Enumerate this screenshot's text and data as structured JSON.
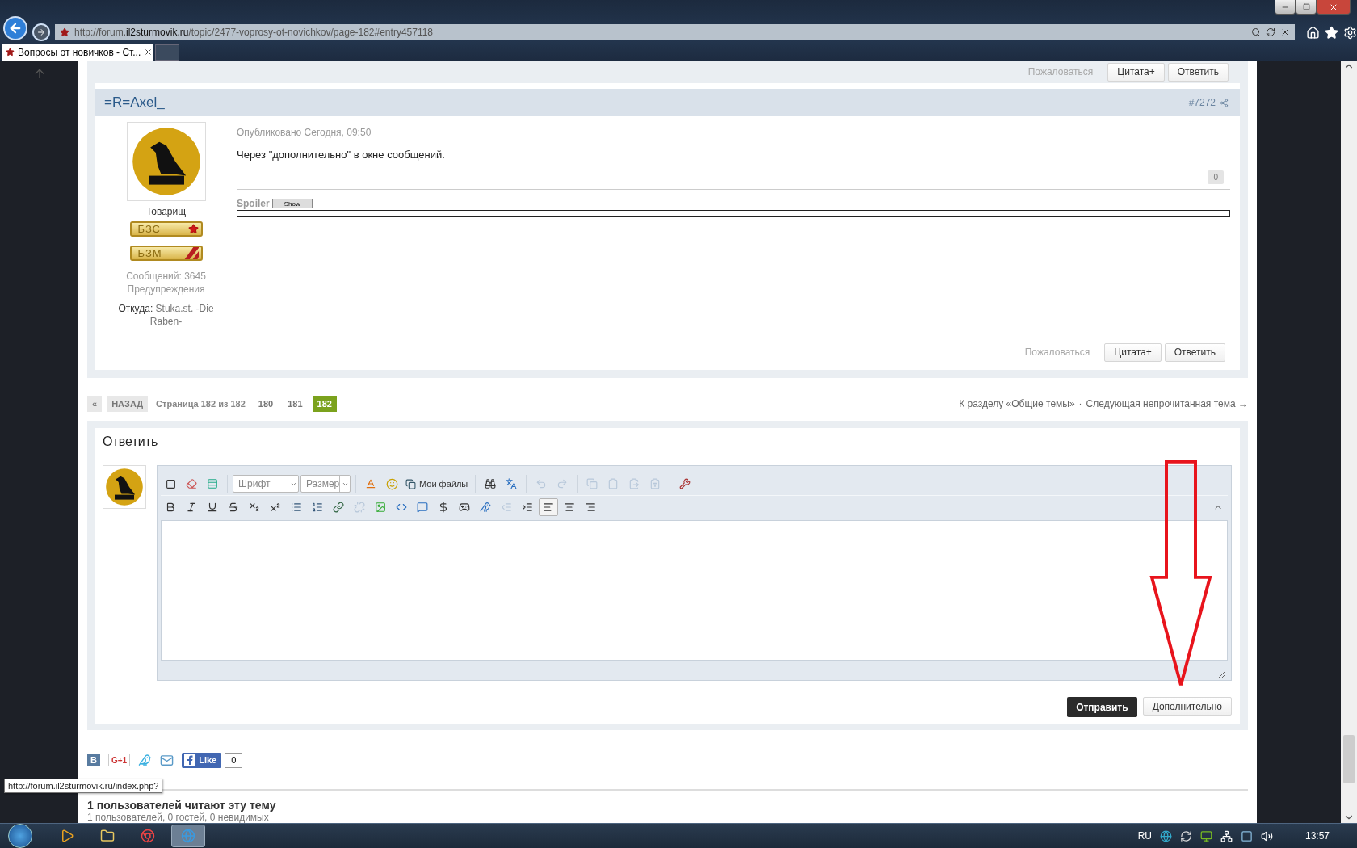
{
  "browser": {
    "url_prefix": "http://forum.",
    "url_domain": "il2sturmovik.ru",
    "url_path": "/topic/2477-voprosy-ot-novichkov/page-182#entry457118",
    "tab_title": "Вопросы от новичков - Ст..."
  },
  "prev_post_actions": {
    "report": "Пожаловаться",
    "quote": "Цитата+",
    "reply": "Ответить"
  },
  "post": {
    "author": "=R=Axel_",
    "number": "#7272",
    "rank": "Товарищ",
    "badges": [
      {
        "label": "БЗС",
        "kind": "star"
      },
      {
        "label": "БЗМ",
        "kind": "stripes"
      }
    ],
    "posts": "Сообщений: 3645",
    "warnings": "Предупреждения",
    "from_label": "Откуда:",
    "from_value": "Stuka.st. -Die Raben-",
    "published": "Опубликовано Сегодня, 09:50",
    "body": "Через \"дополнительно\" в окне сообщений.",
    "reputation": "0",
    "spoiler_label": "Spoiler",
    "spoiler_button": "Show",
    "actions": {
      "report": "Пожаловаться",
      "quote": "Цитата+",
      "reply": "Ответить"
    }
  },
  "pagination": {
    "first": "«",
    "prev": "НАЗАД",
    "info": "Страница 182 из 182",
    "pages": [
      {
        "label": "180",
        "selected": false
      },
      {
        "label": "181",
        "selected": false
      },
      {
        "label": "182",
        "selected": true
      }
    ],
    "forum_link": "К разделу «Общие темы»",
    "separator": "·",
    "next_unread": "Следующая непрочитанная тема →"
  },
  "reply": {
    "title": "Ответить",
    "font_select": "Шрифт",
    "size_select": "Размер",
    "files": "Мои файлы",
    "submit": "Отправить",
    "more": "Дополнительно",
    "history_disabled": true,
    "clipboard_disabled": true,
    "outdent_disabled": true,
    "align": [
      {
        "selected": true
      },
      {
        "selected": false
      },
      {
        "selected": false
      }
    ]
  },
  "share": {
    "vk": "B",
    "gplus": "G+1",
    "like": "Like",
    "like_count": "0"
  },
  "online": {
    "heading": "1 пользователей читают эту тему",
    "detail": "1 пользователей, 0 гостей, 0 невидимых"
  },
  "status_tooltip": "http://forum.il2sturmovik.ru/index.php?",
  "taskbar": {
    "apps": [
      {
        "selected": false
      },
      {
        "selected": false
      },
      {
        "selected": false
      },
      {
        "selected": true
      }
    ],
    "language": "RU",
    "time": "13:57"
  }
}
